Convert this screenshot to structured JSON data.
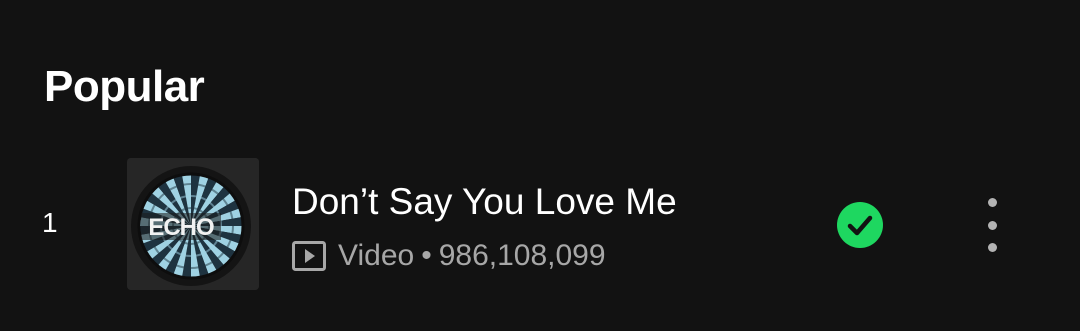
{
  "section": {
    "title": "Popular"
  },
  "tracks": [
    {
      "index": "1",
      "title": "Don’t Say You Love Me",
      "type_icon": "video-icon",
      "type_label": "Video",
      "separator": "•",
      "plays": "986,108,099",
      "cover_text": "ECHO",
      "downloaded": true,
      "status_icon": "downloaded-check-icon",
      "menu_icon": "more-vertical-icon"
    }
  ],
  "colors": {
    "background": "#121212",
    "primary_text": "#ffffff",
    "secondary_text": "#a7a7a7",
    "accent_green": "#1ed760",
    "cover_stripe_light": "#9fd2e3",
    "cover_stripe_dark": "#1e3340"
  }
}
